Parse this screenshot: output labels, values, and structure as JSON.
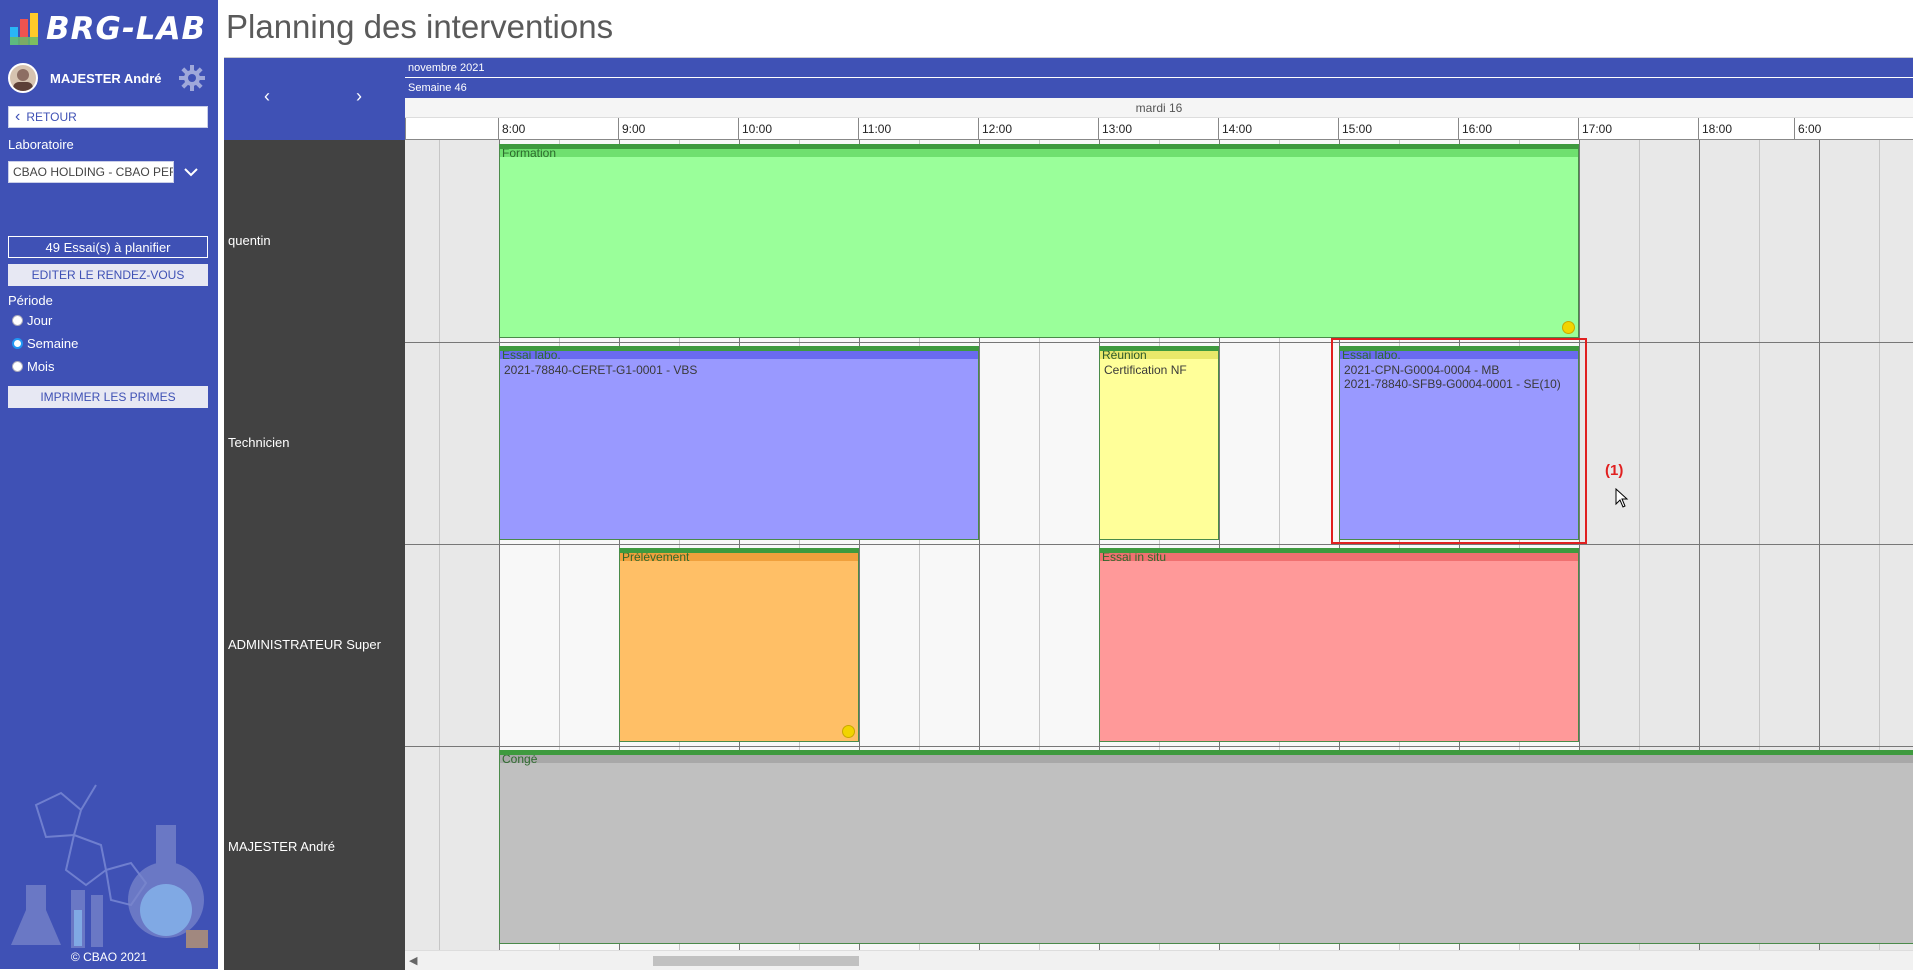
{
  "app": {
    "logo_text": "BRG-LAB",
    "copyright": "© CBAO 2021"
  },
  "user": {
    "name": "MAJESTER André"
  },
  "sidebar": {
    "back_label": "RETOUR",
    "lab_label": "Laboratoire",
    "lab_value": "CBAO HOLDING - CBAO PERPIGNAN",
    "plan_button": "49 Essai(s) à planifier",
    "edit_button": "EDITER LE RENDEZ-VOUS",
    "period_label": "Période",
    "periods": [
      {
        "label": "Jour",
        "checked": false
      },
      {
        "label": "Semaine",
        "checked": true
      },
      {
        "label": "Mois",
        "checked": false
      }
    ],
    "print_button": "IMPRIMER LES PRIMES"
  },
  "page": {
    "title": "Planning des interventions"
  },
  "calendar": {
    "month": "novembre 2021",
    "week": "Semaine 46",
    "day": "mardi 16",
    "nav_prev": "‹",
    "nav_next": "›",
    "hours": [
      "8:00",
      "9:00",
      "10:00",
      "11:00",
      "12:00",
      "13:00",
      "14:00",
      "15:00",
      "16:00",
      "17:00",
      "18:00",
      "6:00"
    ],
    "resources": [
      "quentin",
      "Technicien",
      "ADMINISTRATEUR Super",
      "MAJESTER André"
    ],
    "events": [
      {
        "resource": 0,
        "title": "Formation",
        "start": "8:00",
        "end": "17:00",
        "lines": [],
        "color": "#9aff9a",
        "bar": "#6fe06f",
        "title_color": "#2d6a2d",
        "icon": true
      },
      {
        "resource": 1,
        "title": "Essai labo.",
        "start": "8:00",
        "end": "12:00",
        "lines": [
          "2021-78840-CERET-G1-0001 - VBS"
        ],
        "color": "#9999ff",
        "bar": "#6a6af0",
        "title_color": "#2d6a2d",
        "icon": false
      },
      {
        "resource": 1,
        "title": "Réunion",
        "start": "13:00",
        "end": "14:00",
        "lines": [
          "Certification NF"
        ],
        "color": "#ffff99",
        "bar": "#e8e86a",
        "title_color": "#2d5a2d",
        "icon": false
      },
      {
        "resource": 1,
        "title": "Essai labo.",
        "start": "15:00",
        "end": "17:00",
        "lines": [
          "2021-CPN-G0004-0004 - MB",
          "2021-78840-SFB9-G0004-0001 - SE(10)"
        ],
        "color": "#9999ff",
        "bar": "#6a6af0",
        "title_color": "#2d6a2d",
        "icon": false
      },
      {
        "resource": 2,
        "title": "Prélèvement",
        "start": "9:00",
        "end": "11:00",
        "lines": [],
        "color": "#ffbf66",
        "bar": "#f0a03c",
        "title_color": "#2d6a2d",
        "icon": true
      },
      {
        "resource": 2,
        "title": "Essai in situ",
        "start": "13:00",
        "end": "17:00",
        "lines": [],
        "color": "#ff9999",
        "bar": "#f07070",
        "title_color": "#2d6a2d",
        "icon": false
      },
      {
        "resource": 3,
        "title": "Congé",
        "start": "8:00",
        "end": "23:59",
        "lines": [],
        "color": "#c0c0c0",
        "bar": "#a8a8a8",
        "title_color": "#2d6a2d",
        "icon": false
      }
    ],
    "annotation": "(1)"
  },
  "colors": {
    "primary": "#3f51b5",
    "resource_column": "#424242",
    "annotation": "#e02020"
  }
}
